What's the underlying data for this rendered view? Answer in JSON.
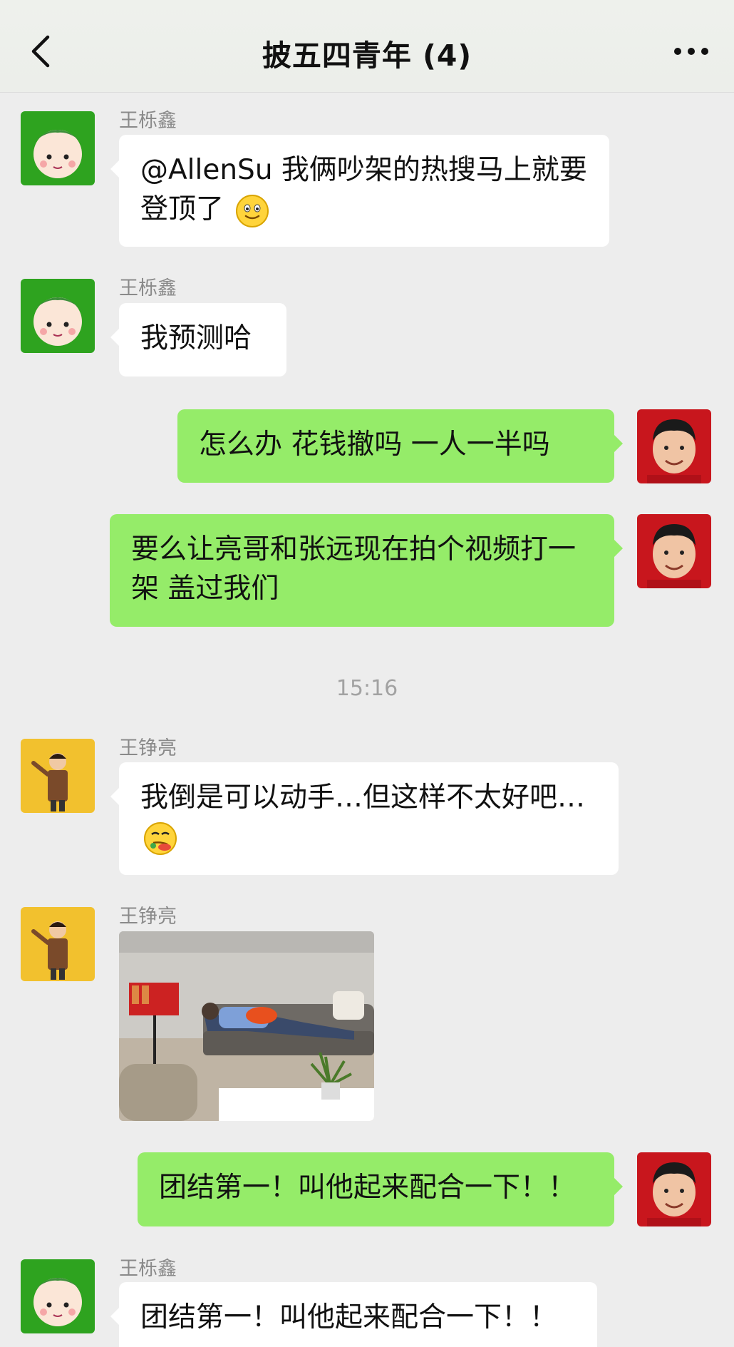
{
  "header": {
    "title": "披五四青年 (4)"
  },
  "messages": [
    {
      "sender": "王栎鑫",
      "text": "@AllenSu 我俩吵架的热搜马上就要登顶了",
      "emoji": "smile-emoji"
    },
    {
      "sender": "王栎鑫",
      "text": "我预测哈"
    },
    {
      "text": "怎么办 花钱撤吗 一人一半吗"
    },
    {
      "text": "要么让亮哥和张远现在拍个视频打一架 盖过我们"
    },
    {
      "sender": "王铮亮",
      "text": "我倒是可以动手…但这样不太好吧…",
      "emoji": "awkward-emoji"
    },
    {
      "sender": "王铮亮",
      "image": "photo-man-sleeping-on-sofa"
    },
    {
      "text": "团结第一！叫他起来配合一下！！"
    },
    {
      "sender": "王栎鑫",
      "text": "团结第一！叫他起来配合一下！！"
    }
  ],
  "timestamp": "15:16",
  "colors": {
    "bubble_self": "#95ec69",
    "bubble_other": "#ffffff",
    "background": "#ededed"
  }
}
